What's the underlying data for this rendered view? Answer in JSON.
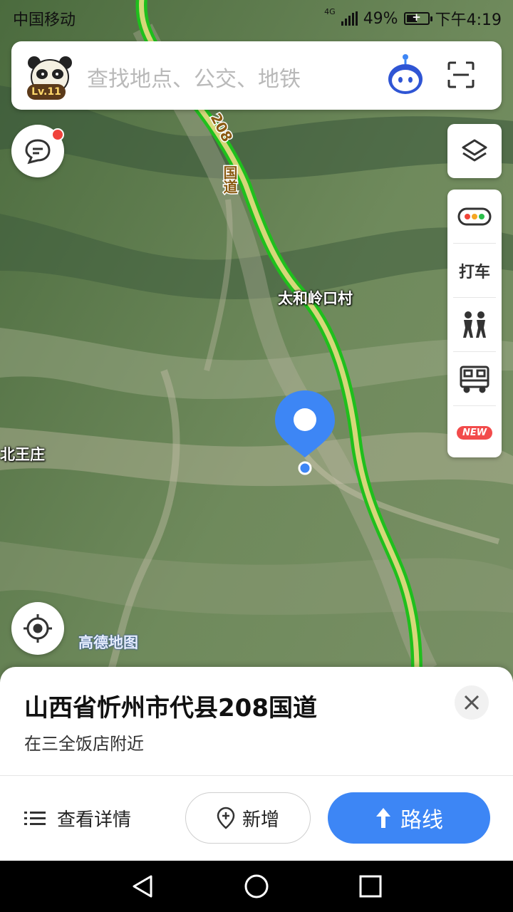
{
  "status_bar": {
    "carrier": "中国移动",
    "network": "4G",
    "battery_text": "49%",
    "battery_level": 0.49,
    "battery_plus": "+",
    "time": "下午4:19"
  },
  "search": {
    "placeholder": "查找地点、公交、地铁",
    "level_badge": "Lv.11"
  },
  "map": {
    "road_label_number": "208",
    "road_label_text": "国道",
    "place_label_1": "太和岭口村",
    "place_label_2": "北王庄",
    "watermark": "高德地图",
    "road_color": "#21c91f",
    "pin_color": "#3d86f5"
  },
  "toolbar": {
    "taxi_label": "打车",
    "new_badge": "NEW",
    "icons": [
      "layers-icon",
      "traffic-icon",
      "walk-icon",
      "bus-icon"
    ]
  },
  "sheet": {
    "title": "山西省忻州市代县208国道",
    "subtitle": "在三全饭店附近",
    "details_label": "查看详情",
    "add_label": "新增",
    "route_label": "路线",
    "accent": "#3d86f5"
  }
}
